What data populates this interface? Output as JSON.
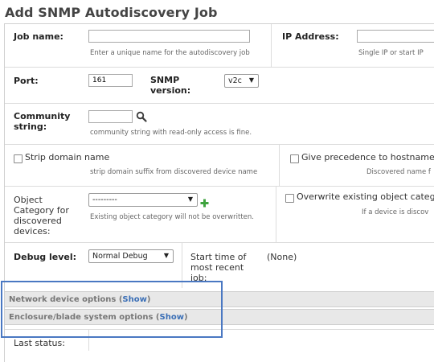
{
  "page": {
    "title": "Add SNMP Autodiscovery Job"
  },
  "job_name": {
    "label": "Job name:",
    "value": "",
    "hint": "Enter a unique name for the autodiscovery job"
  },
  "ip_address": {
    "label": "IP Address:",
    "value": "",
    "hint": "Single IP or start IP"
  },
  "port": {
    "label": "Port:",
    "value": "161"
  },
  "snmp_version": {
    "label_line1": "SNMP",
    "label_line2": "version:",
    "selected": "v2c"
  },
  "community": {
    "label_line1": "Community",
    "label_line2": "string:",
    "value": "",
    "hint": "community string with read-only access is fine."
  },
  "strip_domain": {
    "label": "Strip domain name",
    "checked": false,
    "hint": "strip domain suffix from discovered device name"
  },
  "give_precedence": {
    "label": "Give precedence to hostname",
    "checked": false,
    "hint": "Discovered name f"
  },
  "object_category": {
    "label_line1": "Object",
    "label_line2": "Category for",
    "label_line3": "discovered",
    "label_line4": "devices:",
    "selected": "---------",
    "hint": "Existing object category will not be overwritten."
  },
  "overwrite_category": {
    "label": "Overwrite existing object catego",
    "checked": false,
    "hint": "If a device is discov"
  },
  "debug_level": {
    "label": "Debug level:",
    "selected": "Normal Debug"
  },
  "start_time": {
    "label_line1": "Start time of",
    "label_line2": "most recent",
    "label_line3": "job:",
    "value": "(None)"
  },
  "sections": {
    "network_device": {
      "label": "Network device options (",
      "show": "Show",
      "close": ")"
    },
    "enclosure": {
      "label": "Enclosure/blade system options (",
      "show": "Show",
      "close": ")"
    }
  },
  "last_status": {
    "label": "Last status:"
  },
  "icons": {
    "search": "magnifier-icon",
    "add": "plus-icon",
    "dropdown": "triangle-down-icon"
  },
  "colors": {
    "link": "#3b6fb6",
    "highlight_border": "#4a78c2",
    "add_icon": "#3fa33f"
  }
}
